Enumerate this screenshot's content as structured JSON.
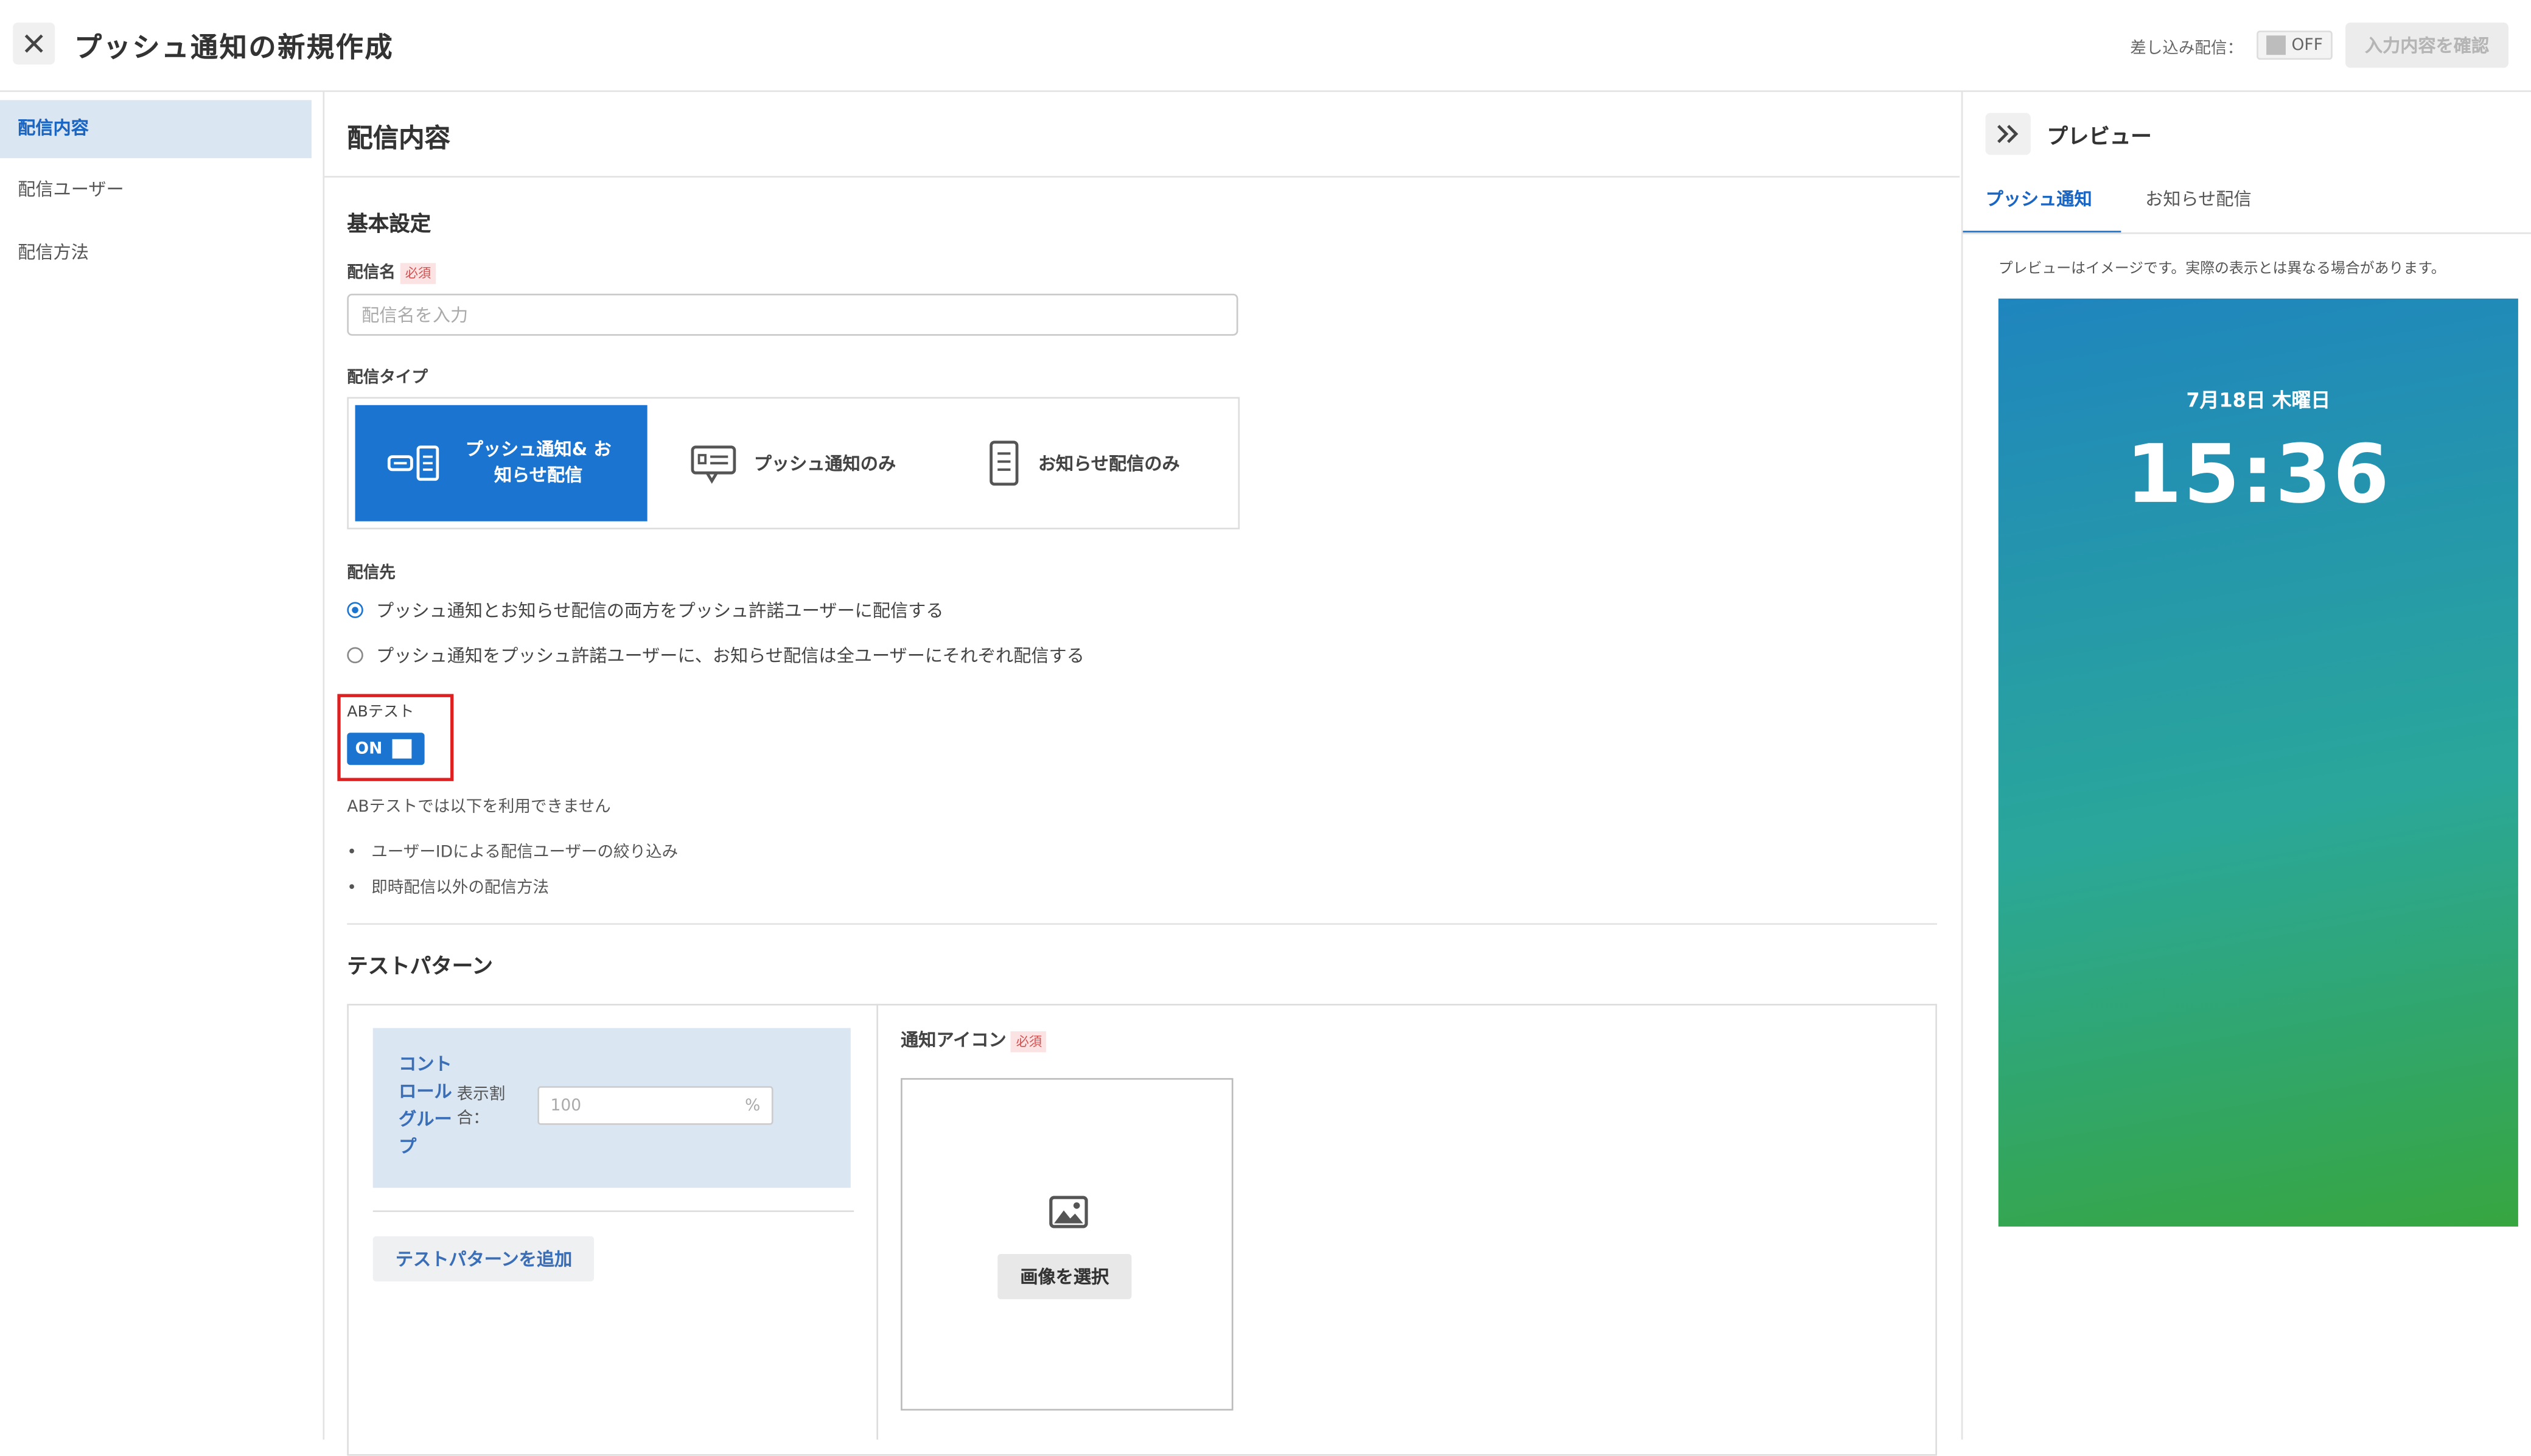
{
  "header": {
    "title": "プッシュ通知の新規作成",
    "inject_label": "差し込み配信：",
    "inject_toggle": "OFF",
    "confirm_button": "入力内容を確認"
  },
  "sidebar": {
    "items": [
      {
        "label": "配信内容",
        "active": true
      },
      {
        "label": "配信ユーザー",
        "active": false
      },
      {
        "label": "配信方法",
        "active": false
      }
    ]
  },
  "main": {
    "section_title": "配信内容",
    "basic_title": "基本設定",
    "name_label": "配信名",
    "required_badge": "必須",
    "name_placeholder": "配信名を入力",
    "type_label": "配信タイプ",
    "types": [
      {
        "label": "プッシュ通知& お知らせ配信",
        "selected": true
      },
      {
        "label": "プッシュ通知のみ",
        "selected": false
      },
      {
        "label": "お知らせ配信のみ",
        "selected": false
      }
    ],
    "dest_label": "配信先",
    "dest_options": [
      {
        "label": "プッシュ通知とお知らせ配信の両方をプッシュ許諾ユーザーに配信する",
        "checked": true
      },
      {
        "label": "プッシュ通知をプッシュ許諾ユーザーに、お知らせ配信は全ユーザーにそれぞれ配信する",
        "checked": false
      }
    ],
    "ab_label": "ABテスト",
    "ab_toggle": "ON",
    "ab_note": "ABテストでは以下を利用できません",
    "ab_bullets": [
      "ユーザーIDによる配信ユーザーの絞り込み",
      "即時配信以外の配信方法"
    ],
    "pattern_title": "テストパターン",
    "control_group_label": "コントロールグループ",
    "ratio_label": "表示割合：",
    "ratio_value": "100",
    "ratio_unit": "%",
    "add_pattern_button": "テストパターンを追加",
    "icon_label": "通知アイコン",
    "select_image_button": "画像を選択"
  },
  "preview": {
    "title": "プレビュー",
    "tabs": [
      {
        "label": "プッシュ通知",
        "active": true
      },
      {
        "label": "お知らせ配信",
        "active": false
      }
    ],
    "note": "プレビューはイメージです。実際の表示とは異なる場合があります。",
    "date": "7月18日 木曜日",
    "time": "15:36"
  }
}
